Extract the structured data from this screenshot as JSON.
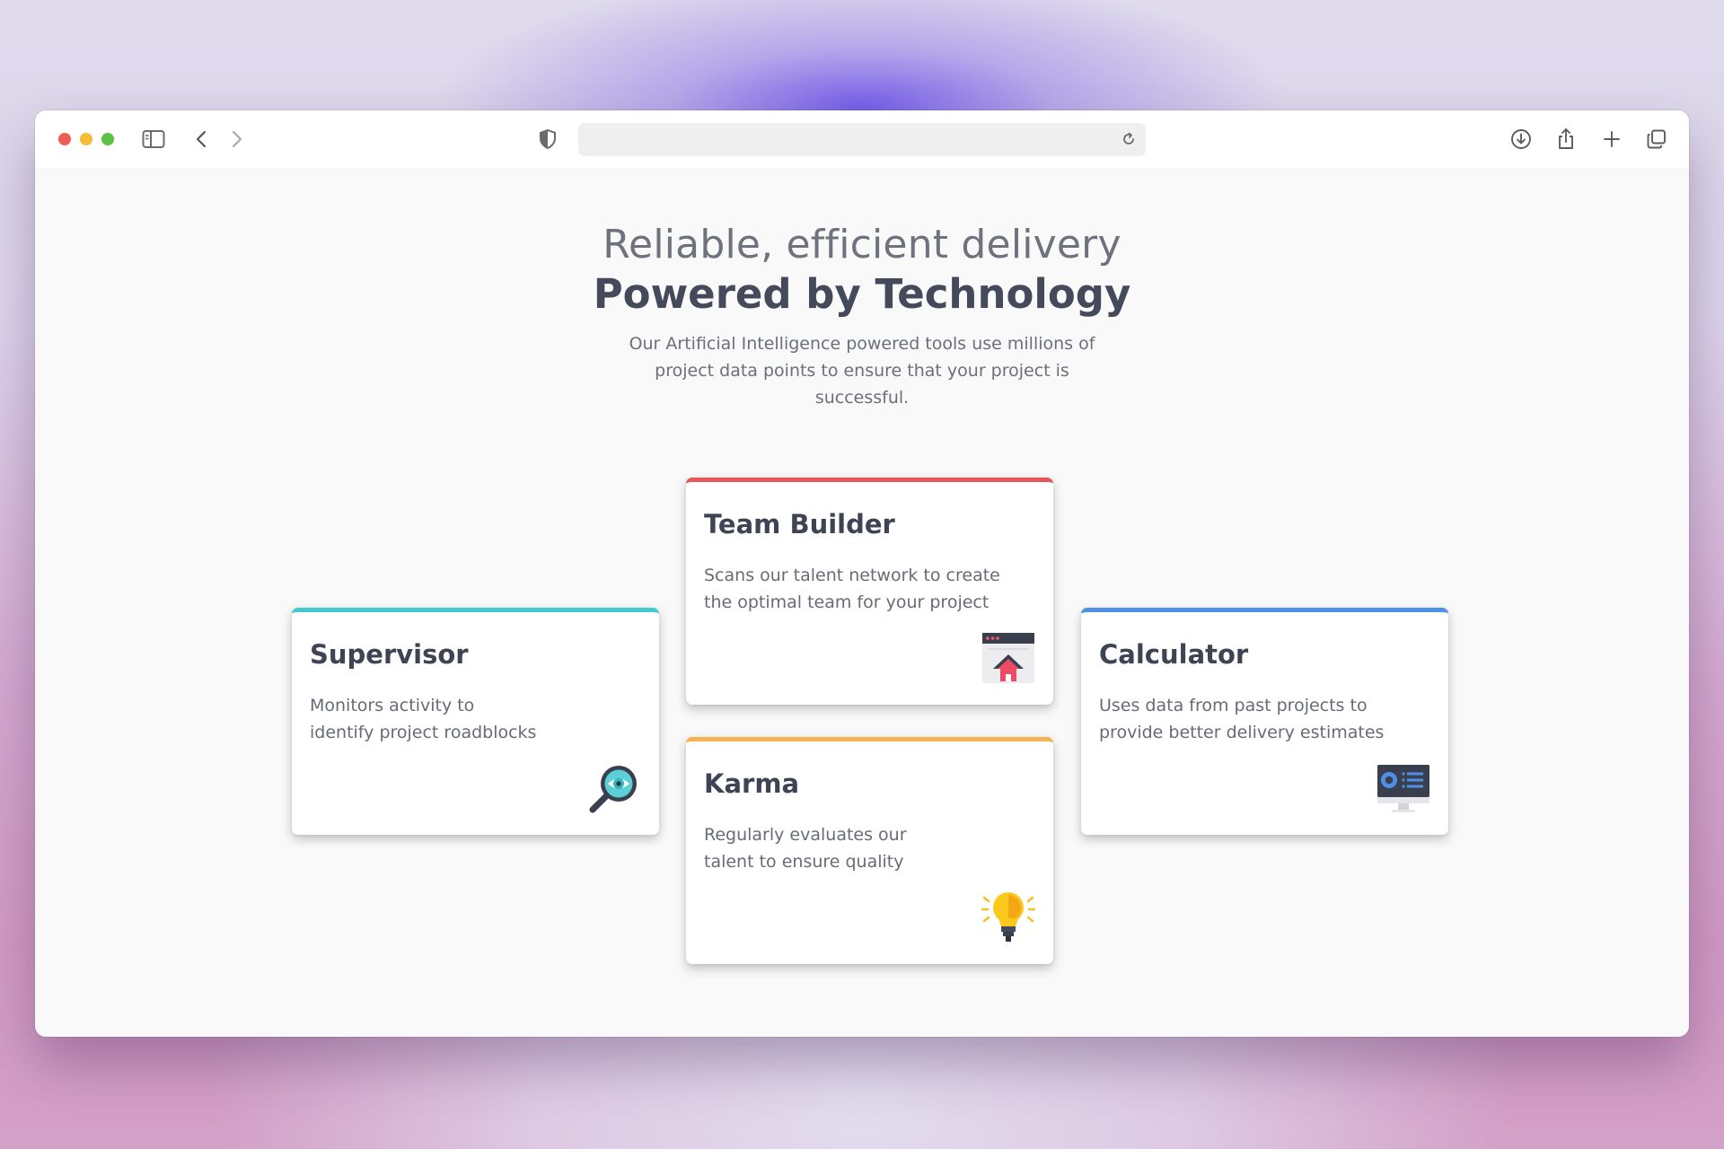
{
  "browser": {
    "toolbar_icons": [
      "sidebar-icon",
      "back-icon",
      "forward-icon",
      "shield-icon",
      "reload-icon",
      "download-icon",
      "share-icon",
      "new-tab-icon",
      "tabs-overview-icon"
    ],
    "url": ""
  },
  "hero": {
    "title_light": "Reliable, efficient delivery",
    "title_bold": "Powered by Technology",
    "subtitle_line1": "Our Artificial Intelligence powered tools use millions of",
    "subtitle_line2": "project data points to ensure that your project is successful."
  },
  "cards": {
    "supervisor": {
      "title": "Supervisor",
      "line1": "Monitors activity to",
      "line2": "identify project roadblocks",
      "accent": "#46c9cd",
      "icon": "magnifier-eye-icon"
    },
    "team_builder": {
      "title": "Team Builder",
      "line1": "Scans our talent network to create",
      "line2": "the optimal team for your project",
      "accent": "#e2585d",
      "icon": "browser-upload-icon"
    },
    "calculator": {
      "title": "Calculator",
      "line1": "Uses data from past projects to",
      "line2": "provide better delivery estimates",
      "accent": "#4f8fe6",
      "icon": "monitor-dashboard-icon"
    },
    "karma": {
      "title": "Karma",
      "line1": "Regularly evaluates our",
      "line2": "talent to ensure quality",
      "accent": "#f4b251",
      "icon": "lightbulb-icon"
    }
  },
  "colors": {
    "heading": "#454a5b",
    "body_text": "#676b75",
    "page_bg": "#f9f9f9"
  }
}
